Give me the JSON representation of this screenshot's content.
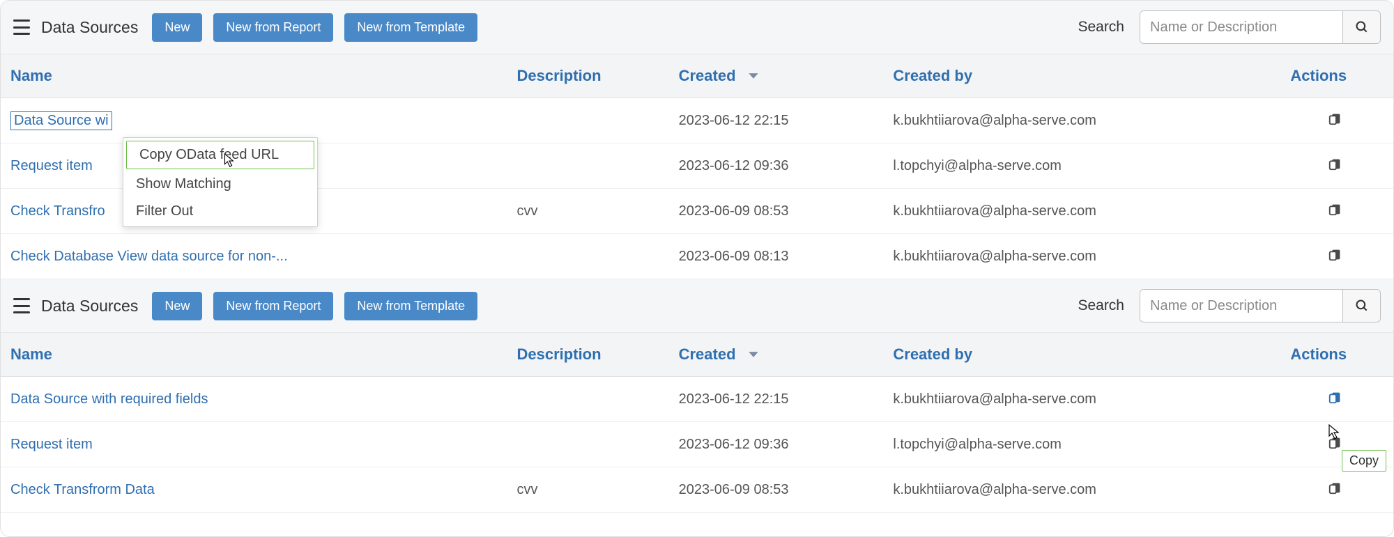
{
  "toolbar": {
    "title": "Data Sources",
    "new_label": "New",
    "new_report_label": "New from Report",
    "new_template_label": "New from Template",
    "search_label": "Search",
    "search_placeholder": "Name or Description"
  },
  "columns": {
    "name": "Name",
    "description": "Description",
    "created": "Created",
    "created_by": "Created by",
    "actions": "Actions"
  },
  "context_menu": {
    "copy_odata": "Copy OData feed URL",
    "show_matching": "Show Matching",
    "filter_out": "Filter Out"
  },
  "tooltip": {
    "copy": "Copy"
  },
  "panel1": {
    "rows": [
      {
        "name": "Data Source with required fields",
        "name_display": "Data Source wi",
        "desc": "",
        "created": "2023-06-12 22:15",
        "by": "k.bukhtiiarova@alpha-serve.com"
      },
      {
        "name": "Request item",
        "desc": "",
        "created": "2023-06-12 09:36",
        "by": "l.topchyi@alpha-serve.com"
      },
      {
        "name": "Check Transfrorm Data",
        "name_display": "Check Transfro",
        "desc": "cvv",
        "created": "2023-06-09 08:53",
        "by": "k.bukhtiiarova@alpha-serve.com"
      },
      {
        "name": "Check Database View data source for non-...",
        "desc": "",
        "created": "2023-06-09 08:13",
        "by": "k.bukhtiiarova@alpha-serve.com"
      }
    ]
  },
  "panel2": {
    "rows": [
      {
        "name": "Data Source with required fields",
        "desc": "",
        "created": "2023-06-12 22:15",
        "by": "k.bukhtiiarova@alpha-serve.com"
      },
      {
        "name": "Request item",
        "desc": "",
        "created": "2023-06-12 09:36",
        "by": "l.topchyi@alpha-serve.com"
      },
      {
        "name": "Check Transfrorm Data",
        "desc": "cvv",
        "created": "2023-06-09 08:53",
        "by": "k.bukhtiiarova@alpha-serve.com"
      }
    ]
  }
}
